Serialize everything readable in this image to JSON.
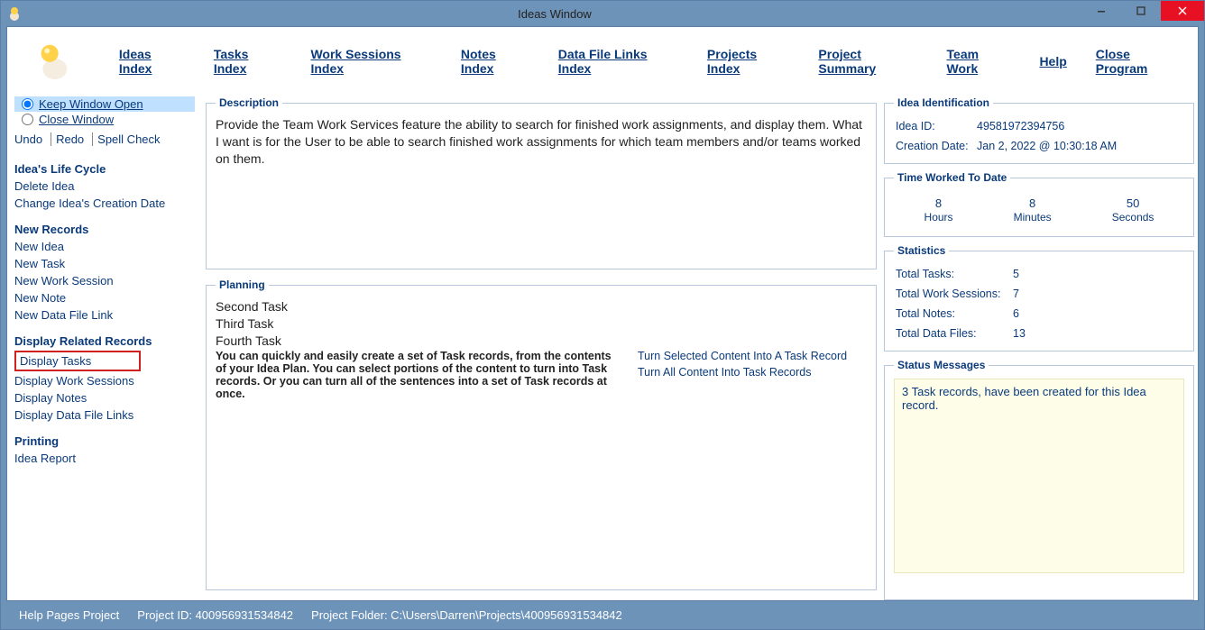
{
  "window": {
    "title": "Ideas Window"
  },
  "menu": {
    "ideas_index": "Ideas Index",
    "tasks_index": "Tasks Index",
    "work_sessions_index": "Work Sessions Index",
    "notes_index": "Notes Index",
    "data_file_links_index": "Data File Links Index",
    "projects_index": "Projects Index",
    "project_summary": "Project Summary",
    "team_work": "Team Work",
    "help": "Help",
    "close_program": "Close Program"
  },
  "sidebar": {
    "keep_open": "Keep Window Open",
    "close_window": "Close Window",
    "undo": "Undo",
    "redo": "Redo",
    "spell_check": "Spell Check",
    "life_cycle_head": "Idea's Life Cycle",
    "delete_idea": "Delete Idea",
    "change_creation": "Change Idea's Creation Date",
    "new_records_head": "New Records",
    "new_idea": "New Idea",
    "new_task": "New Task",
    "new_work_session": "New Work Session",
    "new_note": "New Note",
    "new_data_file_link": "New Data File Link",
    "display_head": "Display Related Records",
    "display_tasks": "Display Tasks",
    "display_work_sessions": "Display Work Sessions",
    "display_notes": "Display Notes",
    "display_data_file_links": "Display Data File Links",
    "printing_head": "Printing",
    "idea_report": "Idea Report"
  },
  "description": {
    "legend": "Description",
    "text": "Provide the Team Work Services feature the ability to search for finished work assignments, and display them. What I want is for the User to be able to search finished work assignments for which team members and/or teams worked on them."
  },
  "planning": {
    "legend": "Planning",
    "lines": [
      "Second Task",
      "Third Task",
      "Fourth Task"
    ],
    "hint": "You can quickly and easily create a set of Task records, from the contents of your Idea Plan. You can select portions of the content to turn into Task records. Or you can turn all of the sentences into a set of Task records at once.",
    "link_selected": "Turn Selected Content Into A Task Record",
    "link_all": "Turn All Content Into Task Records"
  },
  "ident": {
    "legend": "Idea Identification",
    "id_label": "Idea ID:",
    "id_value": "49581972394756",
    "date_label": "Creation Date:",
    "date_value": "Jan  2, 2022 @ 10:30:18 AM"
  },
  "time_worked": {
    "legend": "Time Worked To Date",
    "hours_v": "8",
    "hours_l": "Hours",
    "minutes_v": "8",
    "minutes_l": "Minutes",
    "seconds_v": "50",
    "seconds_l": "Seconds"
  },
  "stats": {
    "legend": "Statistics",
    "tasks_l": "Total Tasks:",
    "tasks_v": "5",
    "ws_l": "Total Work Sessions:",
    "ws_v": "7",
    "notes_l": "Total Notes:",
    "notes_v": "6",
    "files_l": "Total Data Files:",
    "files_v": "13"
  },
  "status": {
    "legend": "Status Messages",
    "text": "3 Task records, have been created for this Idea record."
  },
  "statusbar": {
    "help_pages": "Help Pages Project",
    "project_id": "Project ID:  400956931534842",
    "project_folder": "Project Folder:  C:\\Users\\Darren\\Projects\\400956931534842"
  }
}
